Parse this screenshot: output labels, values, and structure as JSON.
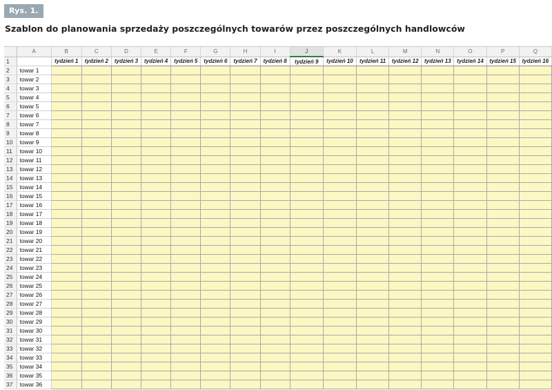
{
  "figure": {
    "label": "Rys. 1.",
    "title": "Szablon do planowania sprzedaży poszczególnych towarów przez poszczególnych handlowców"
  },
  "sheet": {
    "selected_column": "J",
    "column_letters": [
      "A",
      "B",
      "C",
      "D",
      "E",
      "F",
      "G",
      "H",
      "I",
      "J",
      "K",
      "L",
      "M",
      "N",
      "O",
      "P",
      "Q"
    ],
    "header_row": [
      "",
      "tydzień 1",
      "tydzień 2",
      "tydzień 3",
      "tydzień 4",
      "tydzień 5",
      "tydzień 6",
      "tydzień 7",
      "tydzień 8",
      "tydzień 9",
      "tydzień 10",
      "tydzień 11",
      "tydzień 12",
      "tydzień 13",
      "tydzień 14",
      "tydzień 15",
      "tydzień 16"
    ],
    "row_numbers": [
      "1",
      "2",
      "3",
      "4",
      "5",
      "6",
      "7",
      "8",
      "9",
      "10",
      "11",
      "12",
      "13",
      "14",
      "15",
      "16",
      "17",
      "18",
      "19",
      "20",
      "21",
      "22",
      "23",
      "24",
      "25",
      "26",
      "27",
      "28",
      "29",
      "30",
      "31",
      "32",
      "33",
      "34",
      "35",
      "36",
      "37"
    ],
    "products": [
      "towar 1",
      "towar 2",
      "towar 3",
      "towar 4",
      "towar 5",
      "towar 6",
      "towar 7",
      "towar 8",
      "towar 9",
      "towar 10",
      "towar 11",
      "towar 12",
      "towar 13",
      "towar 14",
      "towar 15",
      "towar 16",
      "towar 17",
      "towar 18",
      "towar 19",
      "towar 20",
      "towar 21",
      "towar 22",
      "towar 23",
      "towar 24",
      "towar 25",
      "towar 26",
      "towar 27",
      "towar 28",
      "towar 29",
      "towar 30",
      "towar 31",
      "towar 32",
      "towar 33",
      "towar 34",
      "towar 35",
      "towar 36"
    ],
    "colors": {
      "input_fill": "#fdf7c3",
      "selected_header": "#2f7d3e",
      "badge": "#9aa8b2"
    }
  }
}
